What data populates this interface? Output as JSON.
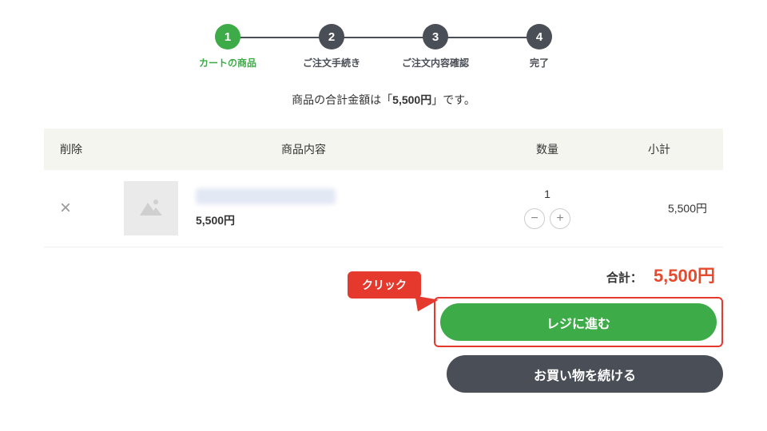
{
  "stepper": {
    "activeIndex": 0,
    "steps": [
      {
        "num": "1",
        "label": "カートの商品"
      },
      {
        "num": "2",
        "label": "ご注文手続き"
      },
      {
        "num": "3",
        "label": "ご注文内容確認"
      },
      {
        "num": "4",
        "label": "完了"
      }
    ]
  },
  "summary": {
    "prefix": "商品の合計金額は「",
    "amount": "5,500円",
    "suffix": "」です。"
  },
  "table": {
    "headers": {
      "delete": "削除",
      "item": "商品内容",
      "qty": "数量",
      "subtotal": "小計"
    },
    "row": {
      "price": "5,500円",
      "qty": "1",
      "subtotal": "5,500円"
    }
  },
  "total": {
    "label": "合計：",
    "amount": "5,500円"
  },
  "tooltip": "クリック",
  "buttons": {
    "checkout": "レジに進む",
    "continue": "お買い物を続ける"
  }
}
